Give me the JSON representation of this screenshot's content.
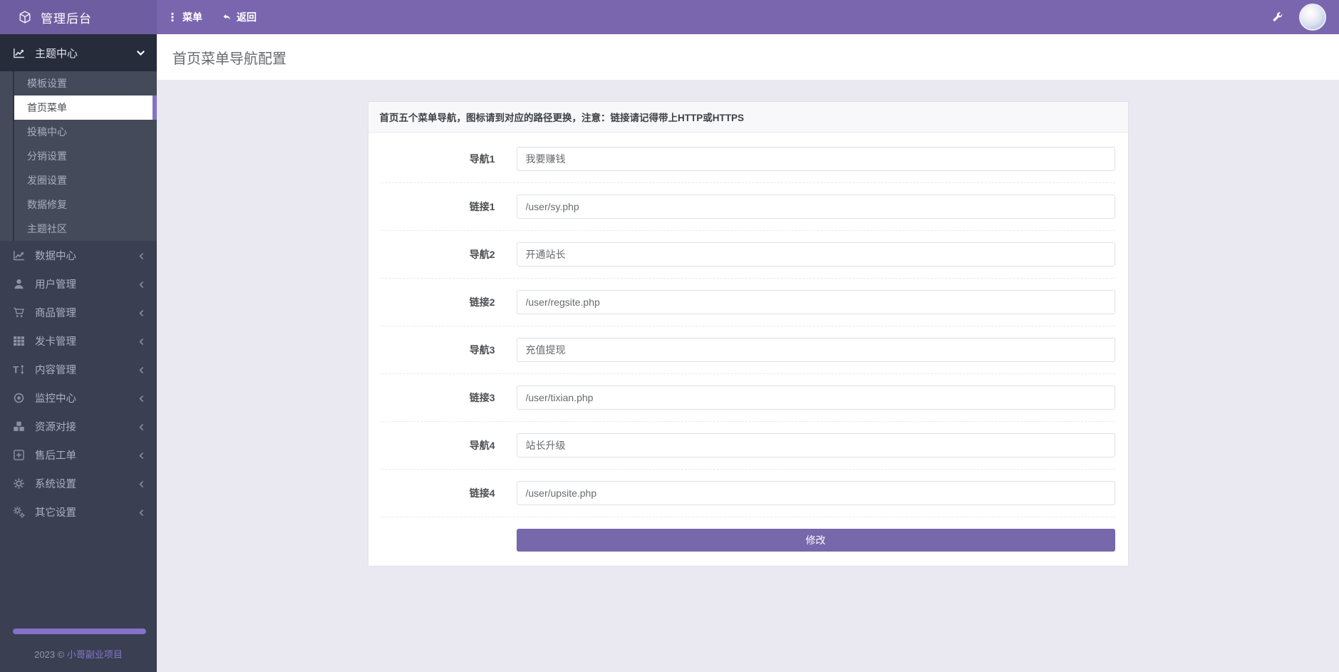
{
  "topbar": {
    "brand": "管理后台",
    "brand_icon": "cube-icon",
    "menu_label": "菜单",
    "menu_icon": "dots-vertical-icon",
    "back_label": "返回",
    "back_icon": "reply-icon",
    "tools_icon": "wrench-icon",
    "avatar": "user-avatar"
  },
  "sidebar": {
    "expanded_item": {
      "label": "主题中心",
      "icon": "line-chart-icon",
      "chevron": "chevron-down-icon"
    },
    "active_submenu_index": 1,
    "submenu": [
      "模板设置",
      "首页菜单",
      "投稿中心",
      "分销设置",
      "发圈设置",
      "数据修复",
      "主题社区"
    ],
    "items": [
      {
        "label": "数据中心",
        "icon": "line-chart-icon"
      },
      {
        "label": "用户管理",
        "icon": "user-icon"
      },
      {
        "label": "商品管理",
        "icon": "cart-icon"
      },
      {
        "label": "发卡管理",
        "icon": "grid-icon"
      },
      {
        "label": "内容管理",
        "icon": "text-icon"
      },
      {
        "label": "监控中心",
        "icon": "circle-dot-icon"
      },
      {
        "label": "资源对接",
        "icon": "cubes-icon"
      },
      {
        "label": "售后工单",
        "icon": "plus-square-icon"
      },
      {
        "label": "系统设置",
        "icon": "gear-icon"
      },
      {
        "label": "其它设置",
        "icon": "gears-icon"
      }
    ],
    "footer": {
      "year_text": "2023 © ",
      "link_text": "小哥副业项目"
    }
  },
  "page": {
    "title": "首页菜单导航配置"
  },
  "panel": {
    "header": "首页五个菜单导航，图标请到对应的路径更换，注意：链接请记得带上HTTP或HTTPS",
    "fields": [
      {
        "label": "导航1",
        "value": "我要赚钱"
      },
      {
        "label": "链接1",
        "value": "/user/sy.php"
      },
      {
        "label": "导航2",
        "value": "开通站长"
      },
      {
        "label": "链接2",
        "value": "/user/regsite.php"
      },
      {
        "label": "导航3",
        "value": "充值提现"
      },
      {
        "label": "链接3",
        "value": "/user/tixian.php"
      },
      {
        "label": "导航4",
        "value": "站长升级"
      },
      {
        "label": "链接4",
        "value": "/user/upsite.php"
      }
    ],
    "submit_label": "修改"
  },
  "colors": {
    "topbar": "#7a66ae",
    "topbar_brand": "#6f5da1",
    "sidebar": "#3a3f51",
    "sidebar_submenu": "#454a5a",
    "active_indicator": "#8373c4",
    "content_background": "#eae8f1",
    "button_accent": "#7767ab",
    "footer_pill": "#8372c8",
    "footer_link": "#8577cd"
  }
}
